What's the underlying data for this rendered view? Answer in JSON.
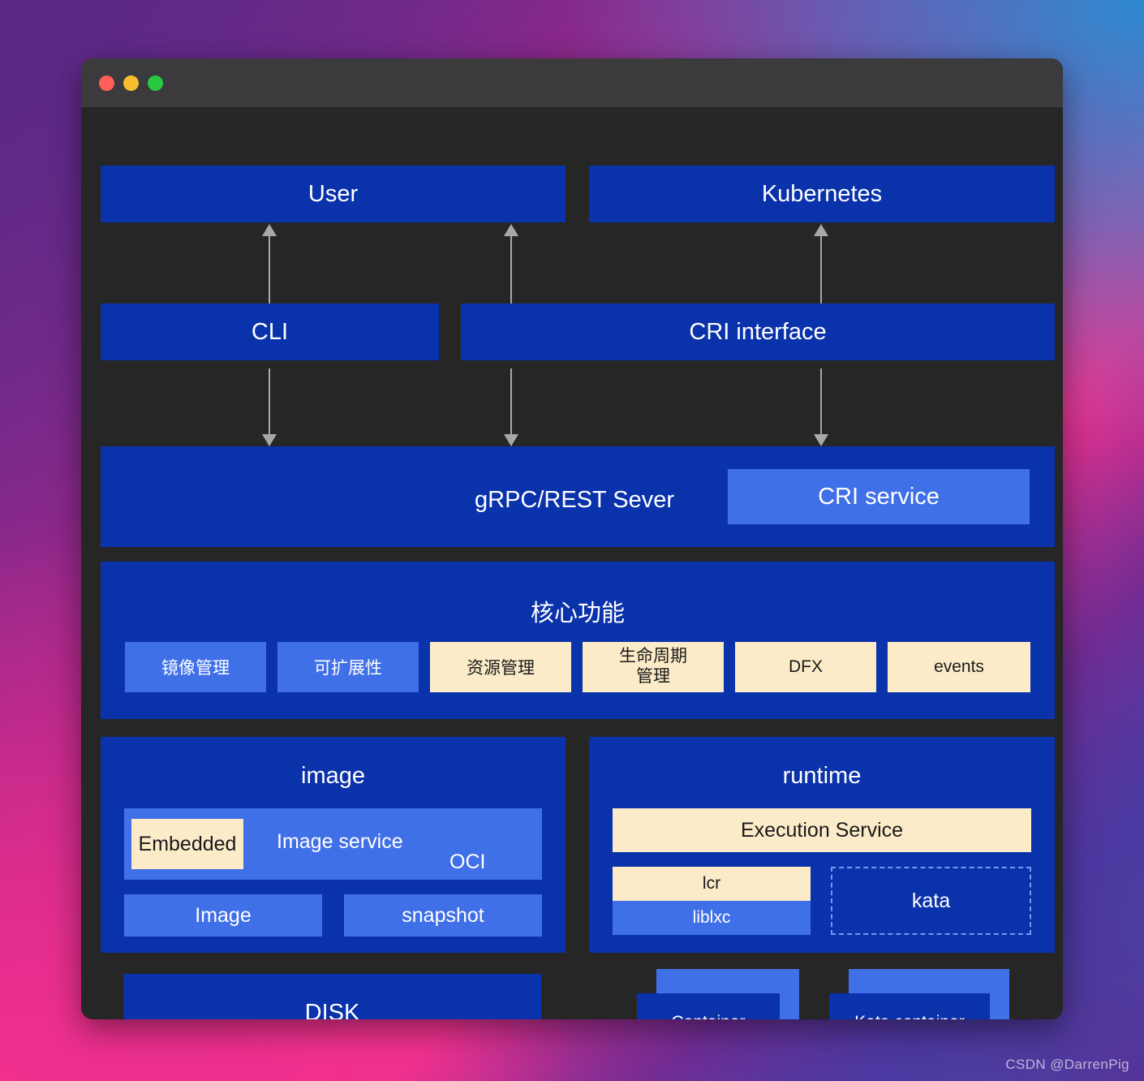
{
  "window": {
    "traffic_lights": [
      "close",
      "minimize",
      "zoom"
    ],
    "colors": {
      "deep_blue": "#0a32ab",
      "mid_blue": "#4070e8",
      "cream": "#fbebc8",
      "window_body": "#262626",
      "titlebar": "#3b3b3d",
      "arrow": "#a8a8a8"
    }
  },
  "diagram": {
    "top_row": {
      "user": "User",
      "kubernetes": "Kubernetes"
    },
    "interface_row": {
      "cli": "CLI",
      "cri_interface": "CRI interface"
    },
    "server_row": {
      "grpc_rest": "gRPC/REST Sever",
      "cri_service": "CRI service"
    },
    "core": {
      "title": "核心功能",
      "items": [
        {
          "label": "镜像管理",
          "style": "mid"
        },
        {
          "label": "可扩展性",
          "style": "mid"
        },
        {
          "label": "资源管理",
          "style": "cream"
        },
        {
          "label": "生命周期\n管理",
          "style": "cream"
        },
        {
          "label": "DFX",
          "style": "cream"
        },
        {
          "label": "events",
          "style": "cream"
        }
      ],
      "lifecycle_line1": "生命周期",
      "lifecycle_line2": "管理"
    },
    "image": {
      "title": "image",
      "embedded": "Embedded",
      "image_service": "Image service",
      "oci": "OCI",
      "image": "Image",
      "snapshot": "snapshot"
    },
    "runtime": {
      "title": "runtime",
      "execution_service": "Execution Service",
      "lcr": "lcr",
      "liblxc": "liblxc",
      "kata": "kata"
    },
    "bottom": {
      "disk": "DISK",
      "container": "Container",
      "kata_container": "Kata container"
    }
  },
  "watermark": "CSDN @DarrenPig"
}
